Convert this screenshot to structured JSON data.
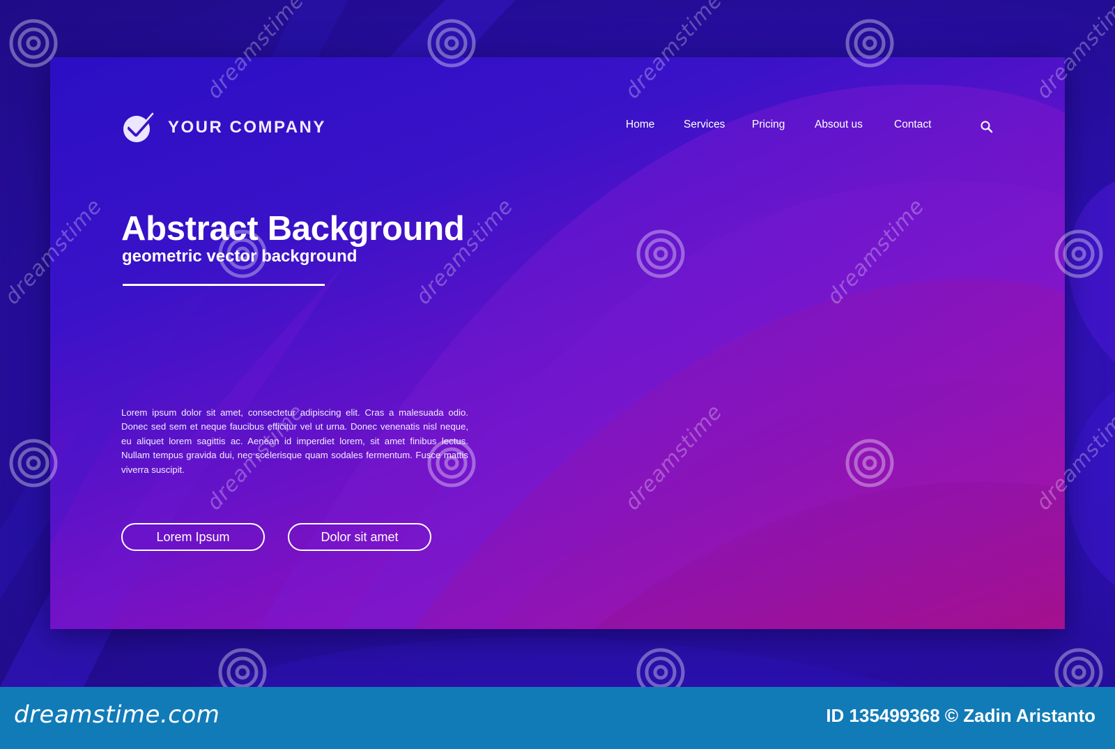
{
  "brand": {
    "name": "YOUR COMPANY",
    "icon": "check-badge-icon"
  },
  "nav": {
    "items": [
      {
        "label": "Home"
      },
      {
        "label": "Services"
      },
      {
        "label": "Pricing"
      },
      {
        "label": "Absout us"
      },
      {
        "label": "Contact"
      }
    ],
    "search_icon": "search-icon"
  },
  "hero": {
    "title": "Abstract Background",
    "subtitle": "geometric vector background",
    "body": "Lorem ipsum dolor sit amet, consectetur adipiscing elit. Cras a malesuada odio. Donec sed sem et neque faucibus efficitur vel ut urna. Donec venenatis nisl neque, eu aliquet lorem sagittis ac. Aenean id imperdiet lorem, sit amet finibus lectus. Nullam tempus gravida dui, nec scelerisque quam sodales fermentum. Fusce mattis viverra suscipit.",
    "buttons": [
      {
        "label": "Lorem Ipsum"
      },
      {
        "label": "Dolor sit amet"
      }
    ]
  },
  "watermark": {
    "text": "dreamstime"
  },
  "footer": {
    "logo": "dreamstime.com",
    "credit": "ID 135499368 © Zadin Aristanto"
  },
  "colors": {
    "background": "#2a0fa8",
    "card_top": "#2b0fc4",
    "card_bottom": "#a2119a",
    "footer": "#117bb8",
    "text": "#ffffff"
  }
}
